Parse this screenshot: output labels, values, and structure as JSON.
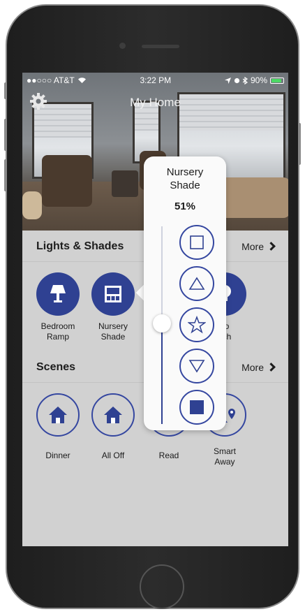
{
  "status_bar": {
    "carrier": "●●○○○ AT&T",
    "time": "3:22 PM",
    "battery": "90%",
    "battery_level": 0.9
  },
  "header": {
    "title": "My Home"
  },
  "lights_shades": {
    "title": "Lights & Shades",
    "more_label": "More",
    "devices": [
      {
        "label_line1": "Bedroom",
        "label_line2": "Ramp",
        "icon": "lamp-icon"
      },
      {
        "label_line1": "Nursery",
        "label_line2": "Shade",
        "icon": "shade-window-icon"
      },
      {
        "label_line1": "tio",
        "label_line2": "itch",
        "icon": "bulb-icon"
      }
    ]
  },
  "scenes": {
    "title": "Scenes",
    "more_label": "More",
    "items": [
      {
        "label_line1": "Dinner",
        "label_line2": "",
        "icon": "house-icon"
      },
      {
        "label_line1": "All Off",
        "label_line2": "",
        "icon": "house-icon"
      },
      {
        "label_line1": "Read",
        "label_line2": "",
        "icon": "scene-icon"
      },
      {
        "label_line1": "Smart",
        "label_line2": "Away",
        "icon": "person-location-icon"
      }
    ]
  },
  "shade_popover": {
    "title_line1": "Nursery",
    "title_line2": "Shade",
    "percent": "51%",
    "level": 0.51,
    "presets": [
      "square-icon",
      "triangle-up-icon",
      "star-icon",
      "triangle-down-icon",
      "filled-square-icon"
    ]
  },
  "colors": {
    "accent": "#2f4192",
    "background": "#d1d1d1"
  }
}
